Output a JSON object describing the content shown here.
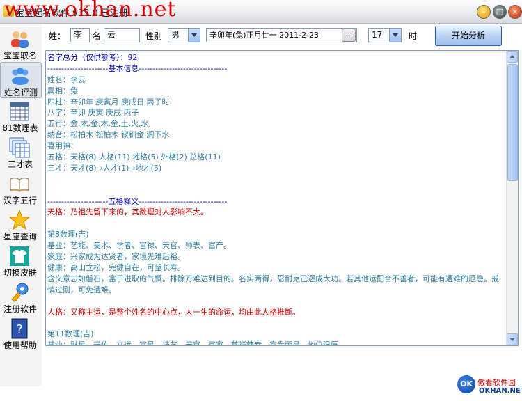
{
  "window": {
    "title": "宝宝起名软件 v13.0 已注册",
    "watermark": "www.okhan.net"
  },
  "sidebar": {
    "items": [
      {
        "label": "宝宝取名",
        "icon": "people-icon"
      },
      {
        "label": "姓名评测",
        "icon": "group-icon",
        "active": true
      },
      {
        "label": "81数理表",
        "icon": "table-icon"
      },
      {
        "label": "三才表",
        "icon": "sheets-icon"
      },
      {
        "label": "汉字五行",
        "icon": "book-icon"
      },
      {
        "label": "星座查询",
        "icon": "star-icon"
      },
      {
        "label": "切换皮肤",
        "icon": "shirt-icon"
      },
      {
        "label": "注册软件",
        "icon": "key-icon"
      },
      {
        "label": "使用帮助",
        "icon": "help-icon"
      }
    ]
  },
  "form": {
    "surname_label": "姓：",
    "surname_value": "李",
    "name_label": "名",
    "name_value": "云",
    "gender_label": "性别",
    "gender_value": "男",
    "date_value": "辛卯年(兔)正月廿一 2011-2-23",
    "date_button": "...",
    "hour_value": "17",
    "hour_label": "时",
    "analyze_button": "开始分析"
  },
  "result": {
    "score_line": "名字总分（仅供参考）：92",
    "basic_header": "----------------------基本信息--------------------------------",
    "basic_lines": [
      "姓名：李云",
      "属相：兔",
      "四柱：辛卯年 庚寅月 庚戌日 丙子时",
      "八字：辛卯 庚寅 庚戌 丙子",
      "五行：金,木,金,木,金,土,火,水,",
      "纳音：松柏木 松柏木 钗钏金 涧下水",
      "喜用神：",
      "五格：天格(8) 人格(11) 地格(5) 外格(2) 总格(11)",
      "三才：天才(8)→人才(1)→地才(5)"
    ],
    "wuge_header": "----------------------五格释义--------------------------------",
    "tiange_desc": "天格：乃祖先留下来的，其数理对人影响不大。",
    "num8_title": "第8数理(吉)",
    "num8_lines": [
      "基业：艺能、美术、学者、官禄、天官、师表、富产。",
      "家庭：兴家成为达贤者，家境先难后裕。",
      "健康：高山立松，完健自在，可望长寿。",
      "含义意志如磐石，富于进取的气慨。排除万难达到目的。名实两得，忍耐克己逐成大功。若其他运配合不善者，可能有遭难的厄患。戒慎过刚，可免遭难。"
    ],
    "renge_desc": "人格：又称主运，是整个姓名的中心点，人一生的命运，均由此人格推断。",
    "num11_title": "第11数理(吉)",
    "num11_partial": "基业：财星、天佑、文运、官星、技艺、天官、富家、慈祥慈幸、富贵荣昌、地位温厚"
  },
  "logo": {
    "mark": "OK",
    "cn": "傲看软件园",
    "en": "OKHAN.NET"
  }
}
